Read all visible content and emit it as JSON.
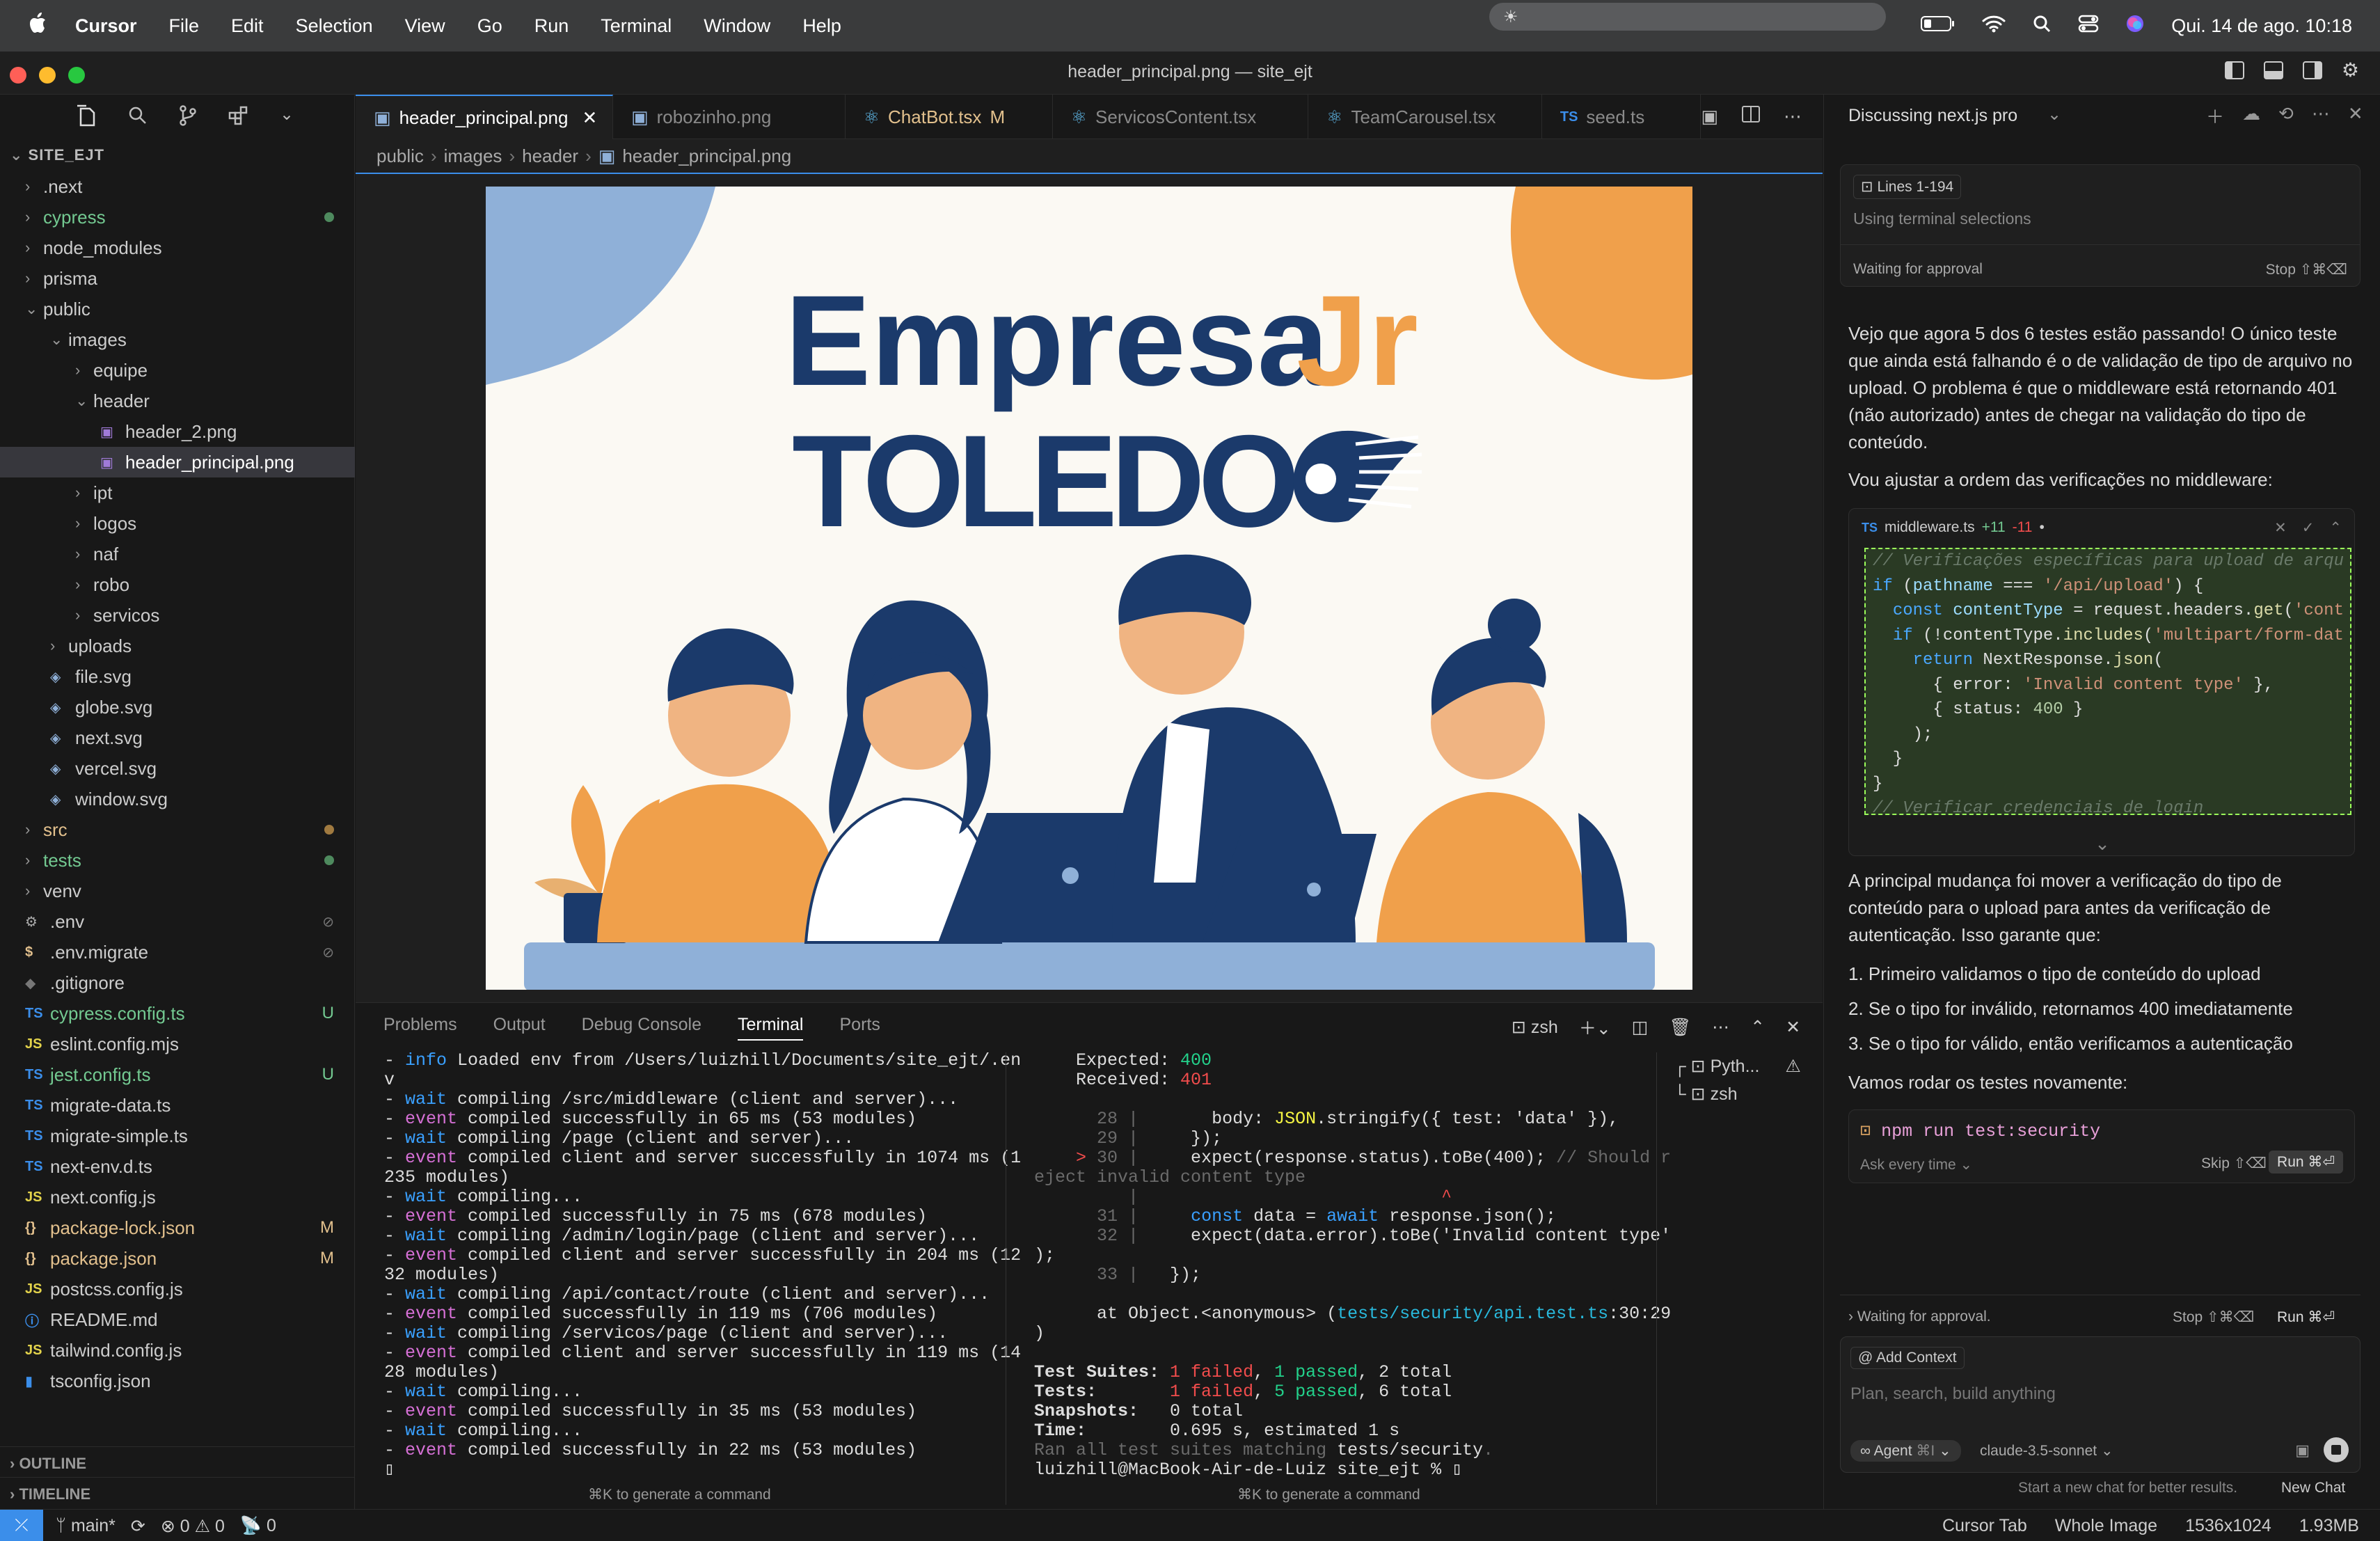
{
  "menubar": {
    "apple": "",
    "app_name": "Cursor",
    "items": [
      "File",
      "Edit",
      "Selection",
      "View",
      "Go",
      "Run",
      "Terminal",
      "Window",
      "Help"
    ],
    "date_time": "Qui. 14 de ago.  10:18"
  },
  "window": {
    "title": "header_principal.png — site_ejt"
  },
  "explorer": {
    "root": "SITE_EJT",
    "items": [
      {
        "label": ".next",
        "kind": "folder",
        "depth": 0
      },
      {
        "label": "cypress",
        "kind": "folder",
        "depth": 0,
        "color": "#73c991",
        "badge": "dot"
      },
      {
        "label": "node_modules",
        "kind": "folder",
        "depth": 0
      },
      {
        "label": "prisma",
        "kind": "folder",
        "depth": 0
      },
      {
        "label": "public",
        "kind": "folder-open",
        "depth": 0
      },
      {
        "label": "images",
        "kind": "folder-open",
        "depth": 1
      },
      {
        "label": "equipe",
        "kind": "folder",
        "depth": 2
      },
      {
        "label": "header",
        "kind": "folder-open",
        "depth": 2
      },
      {
        "label": "header_2.png",
        "kind": "image",
        "depth": 3
      },
      {
        "label": "header_principal.png",
        "kind": "image",
        "depth": 3,
        "selected": true
      },
      {
        "label": "ipt",
        "kind": "folder",
        "depth": 2
      },
      {
        "label": "logos",
        "kind": "folder",
        "depth": 2
      },
      {
        "label": "naf",
        "kind": "folder",
        "depth": 2
      },
      {
        "label": "robo",
        "kind": "folder",
        "depth": 2
      },
      {
        "label": "servicos",
        "kind": "folder",
        "depth": 2
      },
      {
        "label": "uploads",
        "kind": "folder",
        "depth": 1
      },
      {
        "label": "file.svg",
        "kind": "svg",
        "depth": 1
      },
      {
        "label": "globe.svg",
        "kind": "svg",
        "depth": 1
      },
      {
        "label": "next.svg",
        "kind": "svg",
        "depth": 1
      },
      {
        "label": "vercel.svg",
        "kind": "svg",
        "depth": 1
      },
      {
        "label": "window.svg",
        "kind": "svg",
        "depth": 1
      },
      {
        "label": "src",
        "kind": "folder",
        "depth": 0,
        "color": "#e2c08d",
        "badge": "dot-y"
      },
      {
        "label": "tests",
        "kind": "folder",
        "depth": 0,
        "color": "#73c991",
        "badge": "dot"
      },
      {
        "label": "venv",
        "kind": "folder",
        "depth": 0
      },
      {
        "label": ".env",
        "kind": "gear",
        "depth": 0,
        "badge": "ignored"
      },
      {
        "label": ".env.migrate",
        "kind": "dollar",
        "depth": 0,
        "badge": "ignored"
      },
      {
        "label": ".gitignore",
        "kind": "git",
        "depth": 0
      },
      {
        "label": "cypress.config.ts",
        "kind": "ts",
        "depth": 0,
        "color": "#73c991",
        "badge": "U"
      },
      {
        "label": "eslint.config.mjs",
        "kind": "js",
        "depth": 0
      },
      {
        "label": "jest.config.ts",
        "kind": "ts",
        "depth": 0,
        "color": "#73c991",
        "badge": "U"
      },
      {
        "label": "migrate-data.ts",
        "kind": "ts",
        "depth": 0
      },
      {
        "label": "migrate-simple.ts",
        "kind": "ts",
        "depth": 0
      },
      {
        "label": "next-env.d.ts",
        "kind": "ts",
        "depth": 0
      },
      {
        "label": "next.config.js",
        "kind": "js",
        "depth": 0
      },
      {
        "label": "package-lock.json",
        "kind": "json",
        "depth": 0,
        "color": "#e2c08d",
        "badge": "M"
      },
      {
        "label": "package.json",
        "kind": "json",
        "depth": 0,
        "color": "#e2c08d",
        "badge": "M"
      },
      {
        "label": "postcss.config.js",
        "kind": "js",
        "depth": 0
      },
      {
        "label": "README.md",
        "kind": "info",
        "depth": 0
      },
      {
        "label": "tailwind.config.js",
        "kind": "js",
        "depth": 0
      },
      {
        "label": "tsconfig.json",
        "kind": "tsconfig",
        "depth": 0
      }
    ],
    "outline": "OUTLINE",
    "timeline": "TIMELINE"
  },
  "tabs": [
    {
      "label": "header_principal.png",
      "active": true,
      "close": "✕"
    },
    {
      "label": "robozinho.png"
    },
    {
      "label": "ChatBot.tsx",
      "status": "M",
      "color": "#e2c08d"
    },
    {
      "label": "ServicosContent.tsx"
    },
    {
      "label": "TeamCarousel.tsx"
    },
    {
      "label": "seed.ts",
      "prefix": "TS"
    }
  ],
  "breadcrumb": [
    "public",
    "images",
    "header",
    "header_principal.png"
  ],
  "artwork": {
    "line1_a": "Empresa",
    "line1_b": "Jr",
    "line2": "TOLEDO"
  },
  "panel": {
    "tabs": [
      "Problems",
      "Output",
      "Debug Console",
      "Terminal",
      "Ports"
    ],
    "active_tab": "Terminal",
    "shell": "zsh",
    "terminals": [
      "Pyth...",
      "zsh"
    ],
    "hint": "⌘K to generate a command"
  },
  "terminal_left": [
    [
      [
        "- ",
        ""
      ],
      [
        "info",
        "t-blue"
      ],
      [
        " Loaded env from /Users/luizhill/Documents/site_ejt/.en",
        ""
      ]
    ],
    [
      [
        "v",
        ""
      ]
    ],
    [
      [
        "- ",
        ""
      ],
      [
        "wait",
        "t-blue"
      ],
      [
        " compiling /src/middleware (client and server)...",
        ""
      ]
    ],
    [
      [
        "- ",
        ""
      ],
      [
        "event",
        "t-mag"
      ],
      [
        " compiled successfully in 65 ms (53 modules)",
        ""
      ]
    ],
    [
      [
        "- ",
        ""
      ],
      [
        "wait",
        "t-blue"
      ],
      [
        " compiling /page (client and server)...",
        ""
      ]
    ],
    [
      [
        "- ",
        ""
      ],
      [
        "event",
        "t-mag"
      ],
      [
        " compiled client and server successfully in 1074 ms (1",
        ""
      ]
    ],
    [
      [
        "235 modules)",
        ""
      ]
    ],
    [
      [
        "- ",
        ""
      ],
      [
        "wait",
        "t-blue"
      ],
      [
        " compiling...",
        ""
      ]
    ],
    [
      [
        "- ",
        ""
      ],
      [
        "event",
        "t-mag"
      ],
      [
        " compiled successfully in 75 ms (678 modules)",
        ""
      ]
    ],
    [
      [
        "- ",
        ""
      ],
      [
        "wait",
        "t-blue"
      ],
      [
        " compiling /admin/login/page (client and server)...",
        ""
      ]
    ],
    [
      [
        "- ",
        ""
      ],
      [
        "event",
        "t-mag"
      ],
      [
        " compiled client and server successfully in 204 ms (12",
        ""
      ]
    ],
    [
      [
        "32 modules)",
        ""
      ]
    ],
    [
      [
        "- ",
        ""
      ],
      [
        "wait",
        "t-blue"
      ],
      [
        " compiling /api/contact/route (client and server)...",
        ""
      ]
    ],
    [
      [
        "- ",
        ""
      ],
      [
        "event",
        "t-mag"
      ],
      [
        " compiled successfully in 119 ms (706 modules)",
        ""
      ]
    ],
    [
      [
        "- ",
        ""
      ],
      [
        "wait",
        "t-blue"
      ],
      [
        " compiling /servicos/page (client and server)...",
        ""
      ]
    ],
    [
      [
        "- ",
        ""
      ],
      [
        "event",
        "t-mag"
      ],
      [
        " compiled client and server successfully in 119 ms (14",
        ""
      ]
    ],
    [
      [
        "28 modules)",
        ""
      ]
    ],
    [
      [
        "- ",
        ""
      ],
      [
        "wait",
        "t-blue"
      ],
      [
        " compiling...",
        ""
      ]
    ],
    [
      [
        "- ",
        ""
      ],
      [
        "event",
        "t-mag"
      ],
      [
        " compiled successfully in 35 ms (53 modules)",
        ""
      ]
    ],
    [
      [
        "- ",
        ""
      ],
      [
        "wait",
        "t-blue"
      ],
      [
        " compiling...",
        ""
      ]
    ],
    [
      [
        "- ",
        ""
      ],
      [
        "event",
        "t-mag"
      ],
      [
        " compiled successfully in 22 ms (53 modules)",
        ""
      ]
    ]
  ],
  "terminal_right": [
    [
      [
        "    Expected: ",
        ""
      ],
      [
        "400",
        "t-green"
      ]
    ],
    [
      [
        "    Received: ",
        ""
      ],
      [
        "401",
        "t-red"
      ]
    ],
    [
      [
        "",
        ""
      ]
    ],
    [
      [
        "      28 ",
        "t-gray"
      ],
      [
        "|",
        "t-gray"
      ],
      [
        "       body: ",
        ""
      ],
      [
        "JSON",
        "t-yel"
      ],
      [
        ".stringify({ test: ",
        ""
      ],
      [
        "'data'",
        ""
      ],
      [
        " }),",
        ""
      ]
    ],
    [
      [
        "      29 ",
        "t-gray"
      ],
      [
        "|",
        "t-gray"
      ],
      [
        "     });",
        ""
      ]
    ],
    [
      [
        "    > ",
        "t-red"
      ],
      [
        "30 ",
        "t-gray"
      ],
      [
        "|",
        "t-gray"
      ],
      [
        "     expect(response.status).toBe(400); ",
        ""
      ],
      [
        "// Should r",
        "t-gray"
      ]
    ],
    [
      [
        "eject invalid content type",
        "t-gray"
      ]
    ],
    [
      [
        "         ",
        ""
      ],
      [
        "|",
        "t-gray"
      ],
      [
        "                             ",
        ""
      ],
      [
        "^",
        "t-red"
      ]
    ],
    [
      [
        "      31 ",
        "t-gray"
      ],
      [
        "|",
        "t-gray"
      ],
      [
        "     ",
        ""
      ],
      [
        "const",
        "t-blue"
      ],
      [
        " data = ",
        ""
      ],
      [
        "await",
        "t-blue"
      ],
      [
        " response.json();",
        ""
      ]
    ],
    [
      [
        "      32 ",
        "t-gray"
      ],
      [
        "|",
        "t-gray"
      ],
      [
        "     expect(data.error).toBe(",
        ""
      ],
      [
        "'Invalid content type'",
        ""
      ]
    ],
    [
      [
        ");",
        ""
      ]
    ],
    [
      [
        "      33 ",
        "t-gray"
      ],
      [
        "|",
        "t-gray"
      ],
      [
        "   });",
        ""
      ]
    ],
    [
      [
        "",
        ""
      ]
    ],
    [
      [
        "      at Object.<anonymous> (",
        ""
      ],
      [
        "tests/security/api.test.ts",
        "t-cy"
      ],
      [
        ":30:29",
        ""
      ]
    ],
    [
      [
        ")",
        ""
      ]
    ],
    [
      [
        "",
        ""
      ]
    ],
    [
      [
        "Test Suites: ",
        "bold"
      ],
      [
        "1 failed",
        "t-red"
      ],
      [
        ", ",
        ""
      ],
      [
        "1 passed",
        "t-green"
      ],
      [
        ", 2 total",
        ""
      ]
    ],
    [
      [
        "Tests:       ",
        "bold"
      ],
      [
        "1 failed",
        "t-red"
      ],
      [
        ", ",
        ""
      ],
      [
        "5 passed",
        "t-green"
      ],
      [
        ", 6 total",
        ""
      ]
    ],
    [
      [
        "Snapshots:   ",
        "bold"
      ],
      [
        "0 total",
        ""
      ]
    ],
    [
      [
        "Time:        ",
        "bold"
      ],
      [
        "0.695 s, estimated 1 s",
        ""
      ]
    ],
    [
      [
        "Ran all test suites matching ",
        "t-gray"
      ],
      [
        "tests/security",
        ""
      ],
      [
        ".",
        "t-gray"
      ]
    ],
    [
      [
        "luizhill@MacBook-Air-de-Luiz site_ejt % ",
        ""
      ],
      [
        "▯",
        ""
      ]
    ]
  ],
  "chat": {
    "title": "Discussing next.js pro",
    "lines_badge": "Lines 1-194",
    "terminal_sel": "Using terminal selections",
    "waiting": "Waiting for approval",
    "stop": "Stop ⇧⌘⌫",
    "p1": "Vejo que agora 5 dos 6 testes estão passando! O único teste que ainda está falhando é o de validação de tipo de arquivo no upload. O problema é que o middleware está retornando 401 (não autorizado) antes de chegar na validação do tipo de conteúdo.",
    "p2": "Vou ajustar a ordem das verificações no middleware:",
    "file": {
      "prefix": "TS",
      "name": "middleware.ts",
      "added": "+11",
      "removed": "-11"
    },
    "code": [
      [
        [
          "// Verificações específicas para upload de arqu",
          "cm"
        ]
      ],
      [
        [
          "if",
          "kw"
        ],
        [
          " (",
          ""
        ],
        [
          "pathname",
          "vr"
        ],
        [
          " === ",
          ""
        ],
        [
          "'/api/upload'",
          "st"
        ],
        [
          ") {",
          ""
        ]
      ],
      [
        [
          "  ",
          ""
        ],
        [
          "const",
          "kw"
        ],
        [
          " ",
          ""
        ],
        [
          "contentType",
          "vr"
        ],
        [
          " = request.headers.",
          ""
        ],
        [
          "get",
          "fn"
        ],
        [
          "(",
          ""
        ],
        [
          "'cont",
          "st"
        ]
      ],
      [
        [
          "  ",
          ""
        ],
        [
          "if",
          "kw"
        ],
        [
          " (!contentType.",
          ""
        ],
        [
          "includes",
          "fn"
        ],
        [
          "(",
          ""
        ],
        [
          "'multipart/form-dat",
          "st"
        ]
      ],
      [
        [
          "    ",
          ""
        ],
        [
          "return",
          "kw"
        ],
        [
          " NextResponse.",
          ""
        ],
        [
          "json",
          "fn"
        ],
        [
          "(",
          ""
        ]
      ],
      [
        [
          "      { error: ",
          ""
        ],
        [
          "'Invalid content type'",
          "st"
        ],
        [
          " },",
          ""
        ]
      ],
      [
        [
          "      { status: ",
          ""
        ],
        [
          "400",
          "nm"
        ],
        [
          " }",
          ""
        ]
      ],
      [
        [
          "    );",
          ""
        ]
      ],
      [
        [
          "  }",
          ""
        ]
      ],
      [
        [
          "}",
          ""
        ]
      ],
      [
        [
          "// Verificar credenciais de login",
          "cm"
        ]
      ]
    ],
    "p3": "A principal mudança foi mover a verificação do tipo de conteúdo para o upload para antes da verificação de autenticação. Isso garante que:",
    "list": [
      "1. Primeiro validamos o tipo de conteúdo do upload",
      "2. Se o tipo for inválido, retornamos 400 imediatamente",
      "3. Se o tipo for válido, então verificamos a autenticação"
    ],
    "p4": "Vamos rodar os testes novamente:",
    "command": "npm run test:security",
    "ask_every_time": "Ask every time",
    "skip": "Skip ⇧⌫",
    "run": "Run ⌘⏎",
    "bottom_waiting": "Waiting for approval.",
    "bottom_stop": "Stop ⇧⌘⌫",
    "bottom_run": "Run ⌘⏎",
    "add_context": "Add Context",
    "input_placeholder": "Plan, search, build anything",
    "agent": "Agent",
    "agent_shortcut": "⌘I",
    "model": "claude-3.5-sonnet",
    "footer_hint": "Start a new chat for better results.",
    "new_chat": "New Chat"
  },
  "statusbar": {
    "branch": "main*",
    "errors": "0",
    "warnings": "0",
    "ports": "0",
    "cursor_tab": "Cursor Tab",
    "whole_image": "Whole Image",
    "dims": "1536x1024",
    "size": "1.93MB"
  },
  "colors": {
    "accent": "#3b8eea",
    "navy": "#1b3a6b",
    "orange": "#f0a04b",
    "sky": "#8fb0d8"
  }
}
